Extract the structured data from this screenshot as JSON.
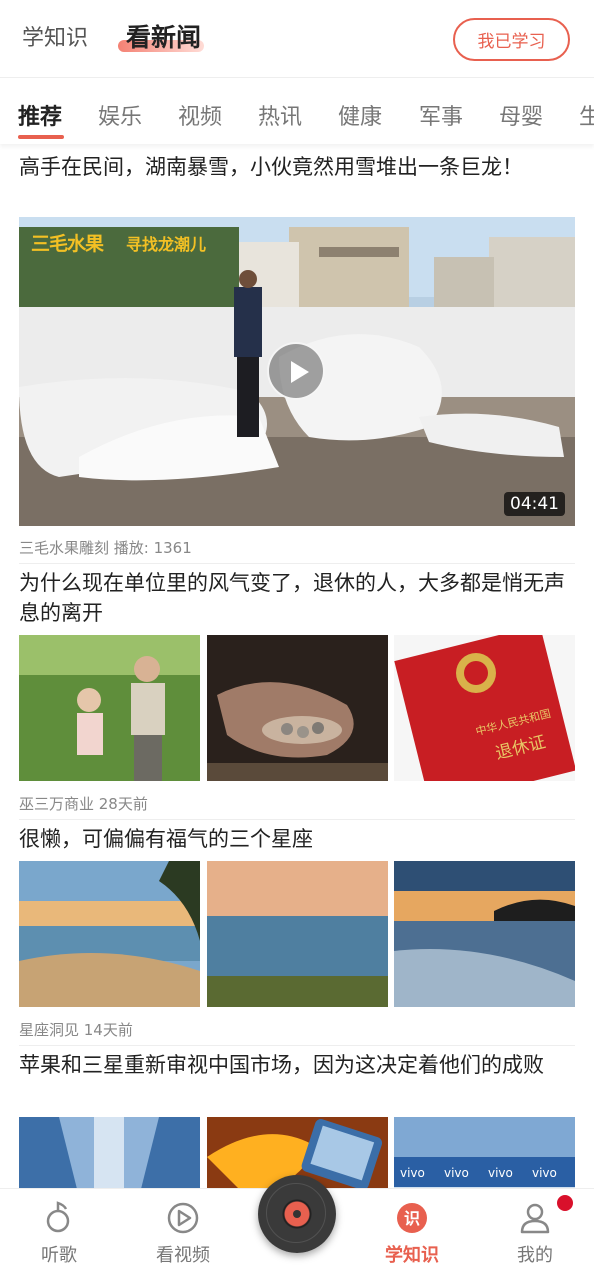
{
  "header": {
    "tab_inactive": "学知识",
    "tab_active": "看新闻",
    "learned_button": "我已学习"
  },
  "categories": [
    "推荐",
    "娱乐",
    "视频",
    "热讯",
    "健康",
    "军事",
    "母婴",
    "生"
  ],
  "articles": [
    {
      "title": "高手在民间，湖南暴雪，小伙竟然用雪堆出一条巨龙！",
      "meta": "三毛水果雕刻 播放: 1361",
      "duration": "04:41",
      "video_logo": "三毛水果",
      "video_logo_sub": "寻找龙潮儿"
    },
    {
      "title": "为什么现在单位里的风气变了，退休的人，大多都是悄无声息的离开",
      "meta": "巫三万商业 28天前",
      "image_text": [
        "中华人民共和国",
        "退休证"
      ]
    },
    {
      "title": "很懒，可偏偏有福气的三个星座",
      "meta": "星座洞见 14天前"
    },
    {
      "title": "苹果和三星重新审视中国市场，因为这决定着他们的成败",
      "image_text": [
        "vivo",
        "vivo",
        "vivo",
        "vivo"
      ]
    }
  ],
  "bottom_nav": [
    {
      "label": "听歌",
      "icon": "music-note-icon"
    },
    {
      "label": "看视频",
      "icon": "play-circle-icon"
    },
    {
      "label": "学知识",
      "icon": "knowledge-icon",
      "active": true
    },
    {
      "label": "我的",
      "icon": "user-icon"
    }
  ],
  "colors": {
    "accent": "#e8604f",
    "badge": "#d9102b"
  }
}
